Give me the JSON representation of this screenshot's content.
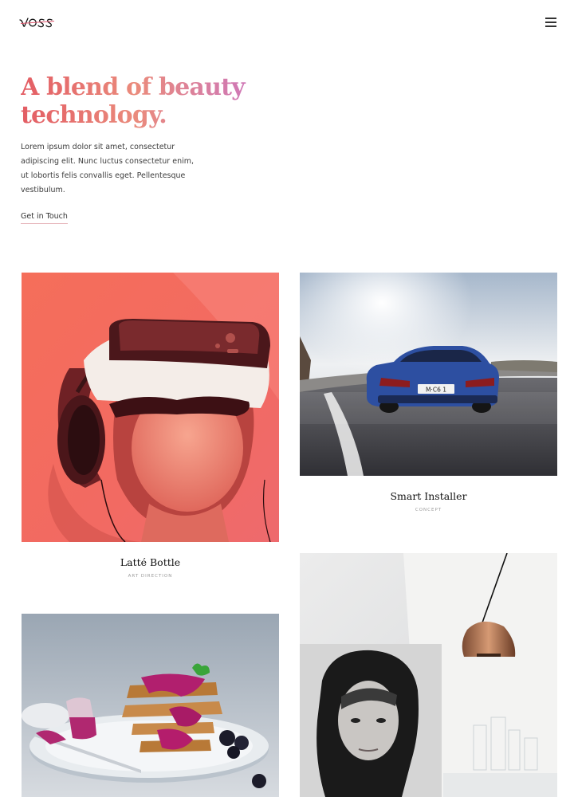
{
  "brand": {
    "logo_text": "voss"
  },
  "nav": {
    "menu_icon": "hamburger-menu-icon"
  },
  "hero": {
    "title_line1": "A blend of beauty",
    "title_line2": "technology.",
    "body": "Lorem ipsum dolor sit amet, consectetur adipiscing elit. Nunc luctus consectetur enim, ut lobortis felis convallis eget. Pellentesque vestibulum.",
    "cta_label": "Get in Touch"
  },
  "portfolio": [
    {
      "title": "Latté Bottle",
      "category": "ART DIRECTION"
    },
    {
      "title": "Smart Installer",
      "category": "CONCEPT"
    },
    {
      "title": "",
      "category": ""
    },
    {
      "title": "",
      "category": ""
    }
  ],
  "colors": {
    "accent_gradient_start": "#e35d64",
    "accent_gradient_end": "#c873c6",
    "cta_underline": "#e7b8bd"
  }
}
